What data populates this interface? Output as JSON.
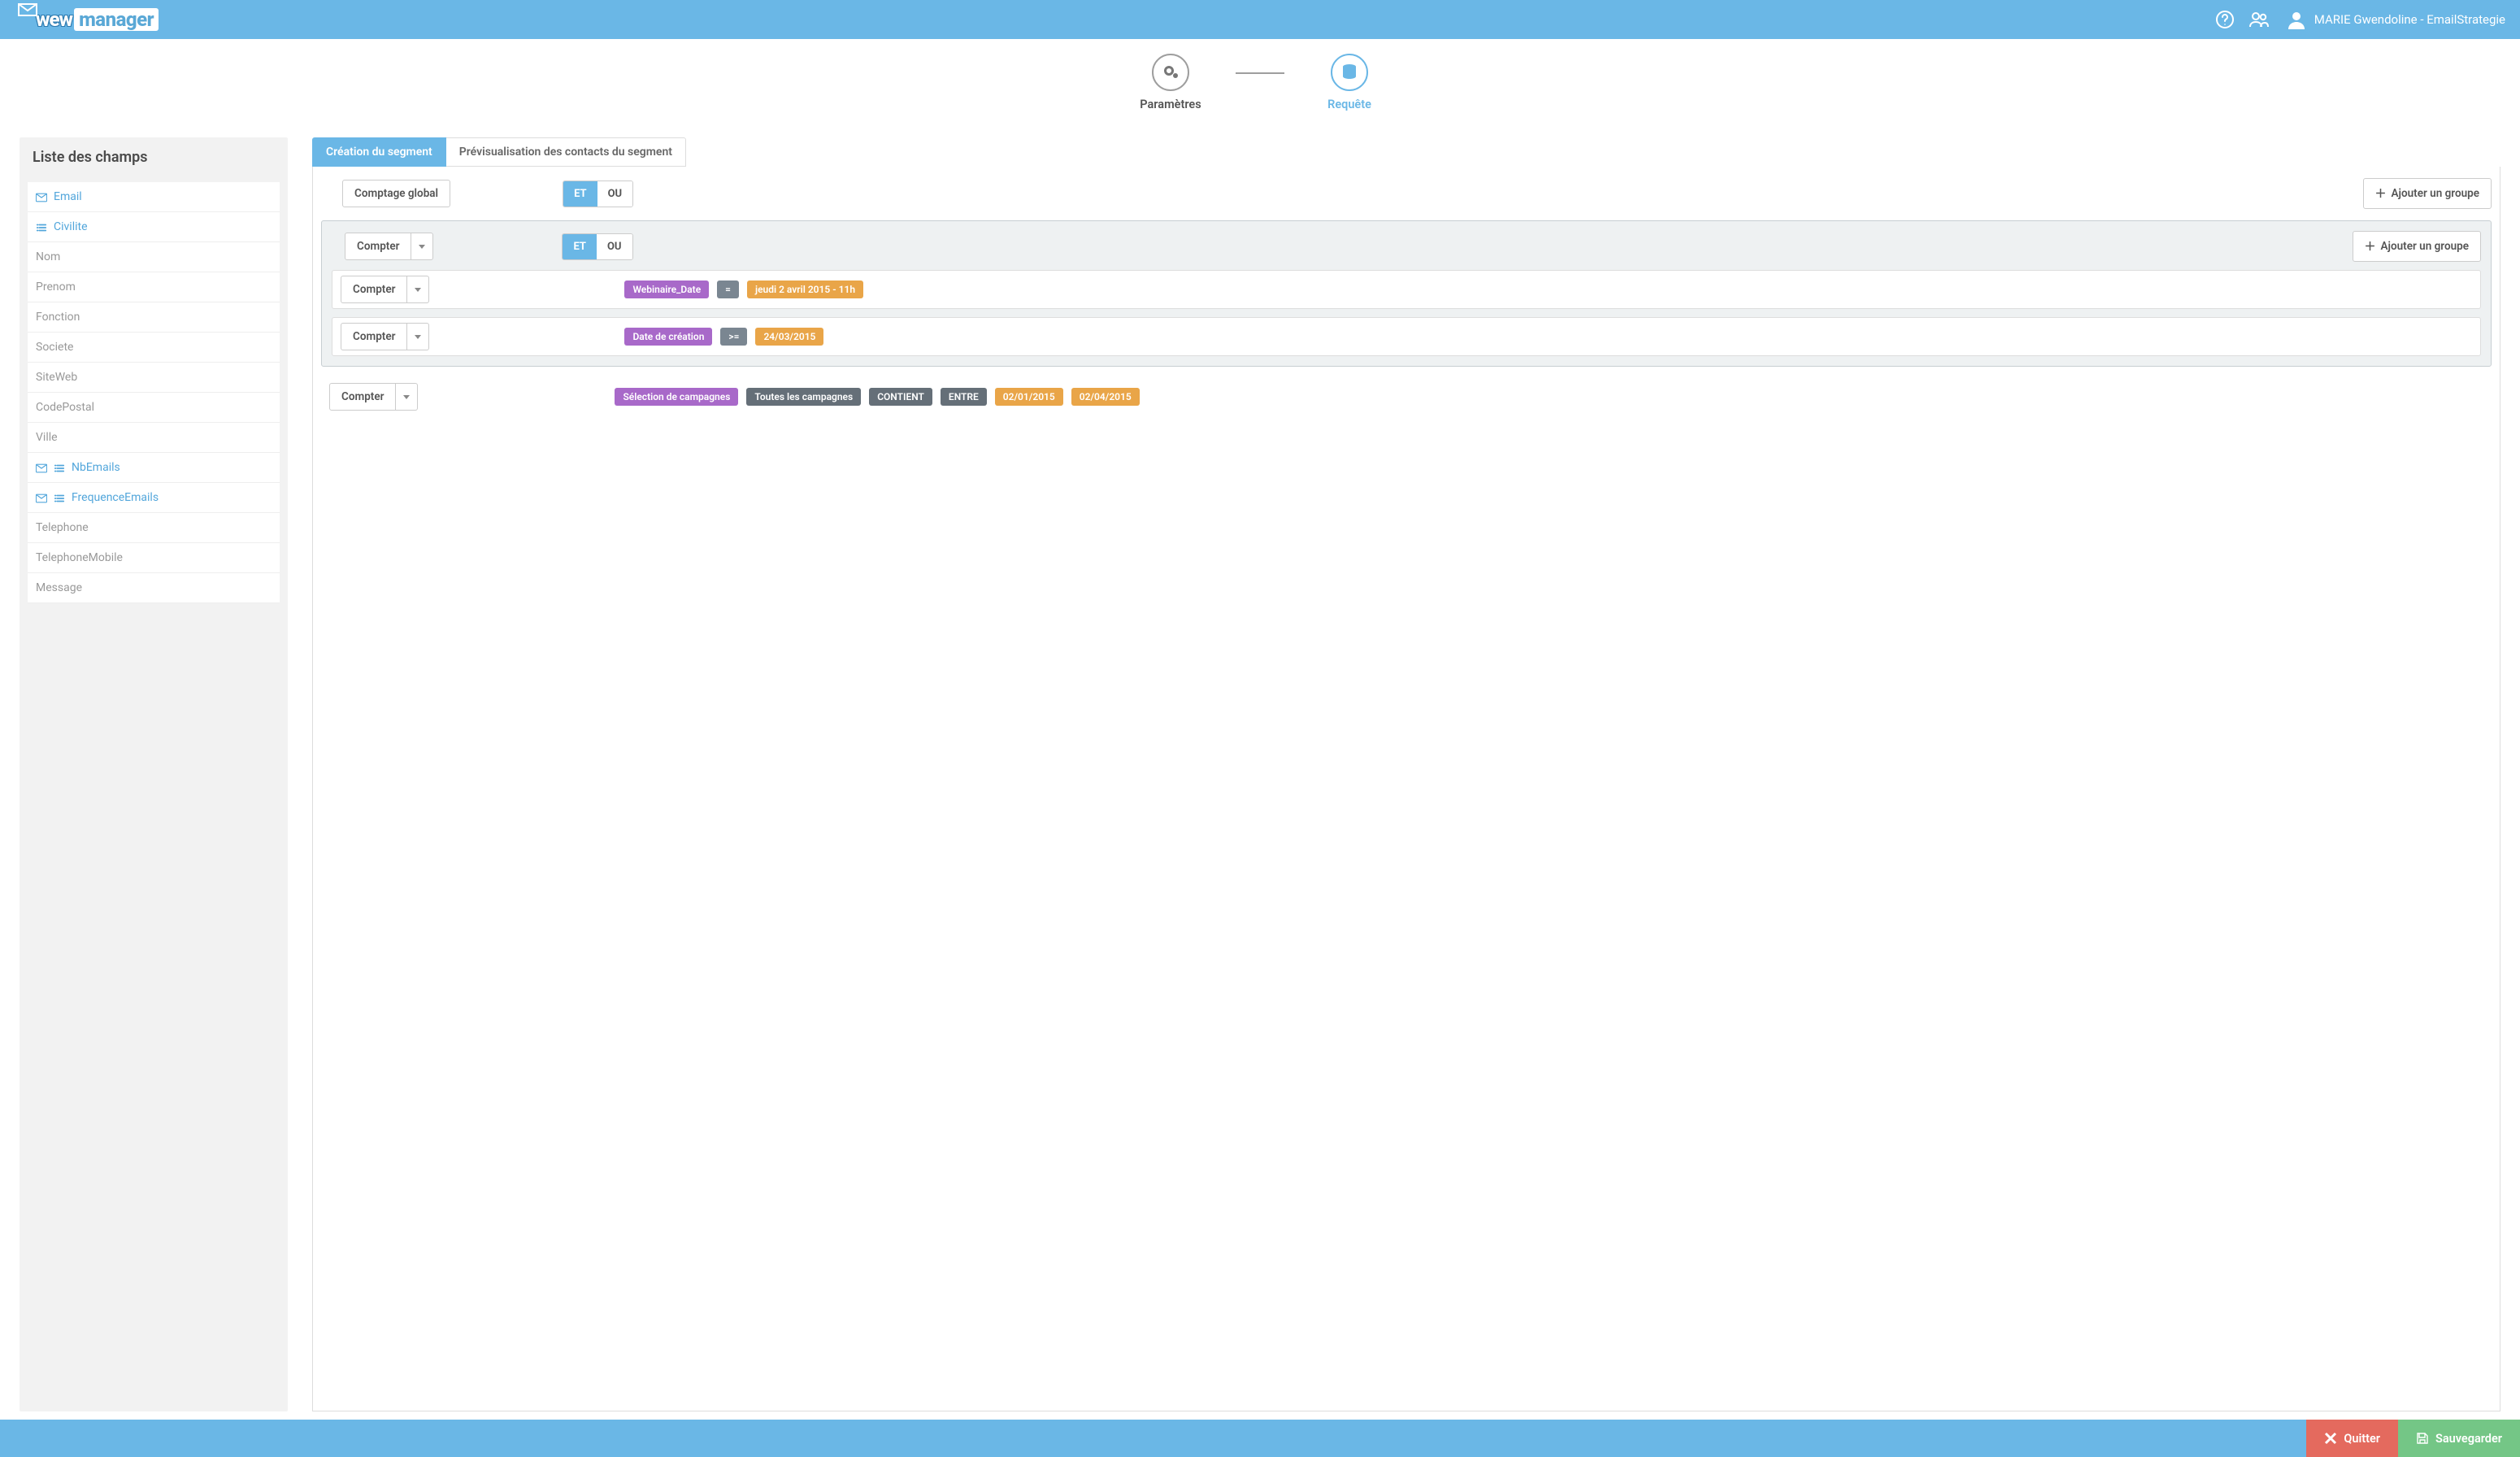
{
  "header": {
    "brand_left": "wew",
    "brand_right": "manager",
    "user_label": "MARIE Gwendoline - EmailStrategie"
  },
  "steps": {
    "parametres": "Paramètres",
    "requete": "Requête"
  },
  "sidebar": {
    "title": "Liste des champs",
    "fields": [
      {
        "label": "Email",
        "icons": [
          "mail"
        ],
        "grey": false
      },
      {
        "label": "Civilite",
        "icons": [
          "list"
        ],
        "grey": false
      },
      {
        "label": "Nom",
        "icons": [],
        "grey": true
      },
      {
        "label": "Prenom",
        "icons": [],
        "grey": true
      },
      {
        "label": "Fonction",
        "icons": [],
        "grey": true
      },
      {
        "label": "Societe",
        "icons": [],
        "grey": true
      },
      {
        "label": "SiteWeb",
        "icons": [],
        "grey": true
      },
      {
        "label": "CodePostal",
        "icons": [],
        "grey": true
      },
      {
        "label": "Ville",
        "icons": [],
        "grey": true
      },
      {
        "label": "NbEmails",
        "icons": [
          "mail",
          "list"
        ],
        "grey": false
      },
      {
        "label": "FrequenceEmails",
        "icons": [
          "mail",
          "list"
        ],
        "grey": false
      },
      {
        "label": "Telephone",
        "icons": [],
        "grey": true
      },
      {
        "label": "TelephoneMobile",
        "icons": [],
        "grey": true
      },
      {
        "label": "Message",
        "icons": [],
        "grey": true
      }
    ]
  },
  "tabs": {
    "creation": "Création du segment",
    "preview": "Prévisualisation des contacts du segment"
  },
  "builder": {
    "global_count": "Comptage global",
    "et": "ET",
    "ou": "OU",
    "add_group": "Ajouter un groupe",
    "compter": "Compter",
    "rules": {
      "r1_field": "Webinaire_Date",
      "r1_op": "=",
      "r1_val": "jeudi 2 avril 2015 - 11h",
      "r2_field": "Date de création",
      "r2_op": ">=",
      "r2_val": "24/03/2015",
      "r3_field": "Sélection de campagnes",
      "r3_scope": "Toutes les campagnes",
      "r3_op": "CONTIENT",
      "r3_range": "ENTRE",
      "r3_d1": "02/01/2015",
      "r3_d2": "02/04/2015"
    }
  },
  "footer": {
    "quit": "Quitter",
    "save": "Sauvegarder"
  }
}
